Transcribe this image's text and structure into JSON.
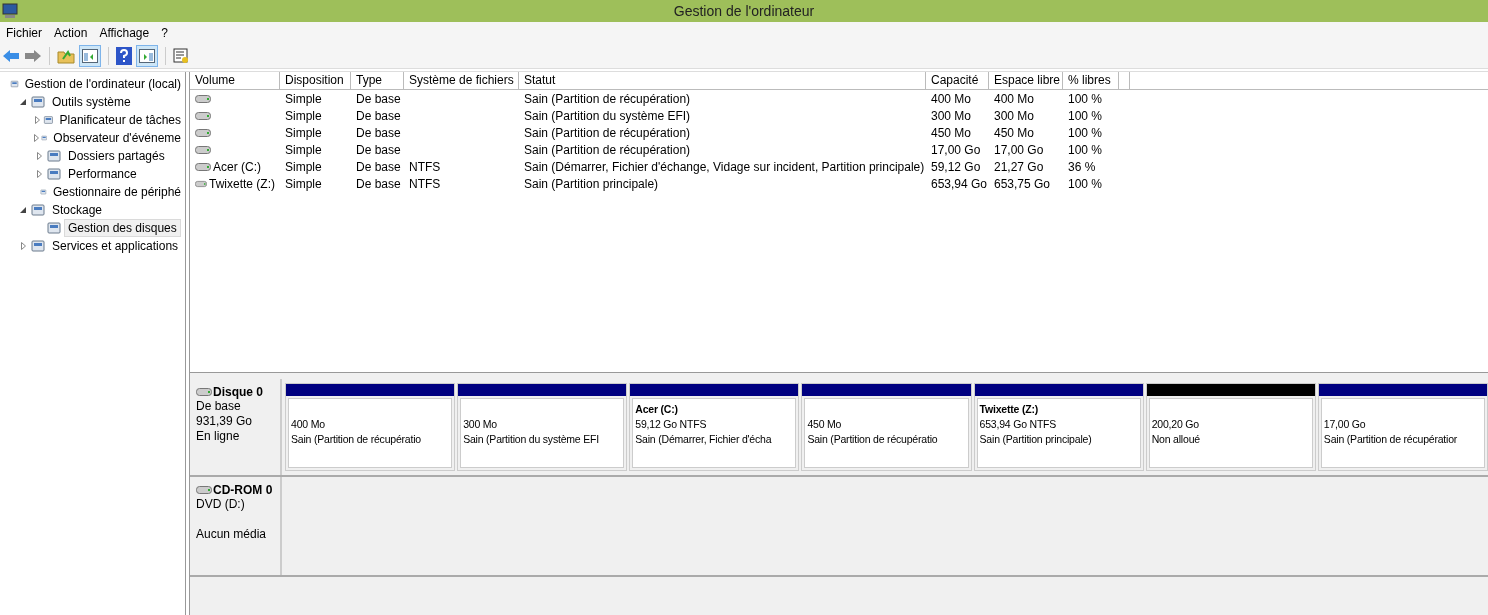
{
  "window": {
    "title": "Gestion de l'ordinateur"
  },
  "menu": [
    "Fichier",
    "Action",
    "Affichage",
    "?"
  ],
  "tree": [
    {
      "label": "Gestion de l'ordinateur (local)",
      "selected": false,
      "children": [
        {
          "label": "Outils système",
          "expanded": true,
          "selected": false,
          "children": [
            {
              "label": "Planificateur de tâches",
              "expanded": false,
              "selected": false
            },
            {
              "label": "Observateur d'événeme",
              "expanded": false,
              "selected": false
            },
            {
              "label": "Dossiers partagés",
              "expanded": false,
              "selected": false
            },
            {
              "label": "Performance",
              "expanded": false,
              "selected": false
            },
            {
              "label": "Gestionnaire de périphé",
              "selected": false
            }
          ]
        },
        {
          "label": "Stockage",
          "expanded": true,
          "selected": false,
          "children": [
            {
              "label": "Gestion des disques",
              "selected": true
            }
          ]
        },
        {
          "label": "Services et applications",
          "expanded": false,
          "selected": false
        }
      ]
    }
  ],
  "table": {
    "columns": [
      "Volume",
      "Disposition",
      "Type",
      "Système de fichiers",
      "Statut",
      "Capacité",
      "Espace libre",
      "% libres"
    ],
    "rows": [
      [
        "",
        "Simple",
        "De base",
        "",
        "Sain (Partition de récupération)",
        "400 Mo",
        "400 Mo",
        "100 %"
      ],
      [
        "",
        "Simple",
        "De base",
        "",
        "Sain (Partition du système EFI)",
        "300 Mo",
        "300 Mo",
        "100 %"
      ],
      [
        "",
        "Simple",
        "De base",
        "",
        "Sain (Partition de récupération)",
        "450 Mo",
        "450 Mo",
        "100 %"
      ],
      [
        "",
        "Simple",
        "De base",
        "",
        "Sain (Partition de récupération)",
        "17,00 Go",
        "17,00 Go",
        "100 %"
      ],
      [
        "Acer (C:)",
        "Simple",
        "De base",
        "NTFS",
        "Sain (Démarrer, Fichier d'échange, Vidage sur incident, Partition principale)",
        "59,12 Go",
        "21,27 Go",
        "36 %"
      ],
      [
        "Twixette (Z:)",
        "Simple",
        "De base",
        "NTFS",
        "Sain (Partition principale)",
        "653,94 Go",
        "653,75 Go",
        "100 %"
      ]
    ]
  },
  "disks": [
    {
      "name": "Disque 0",
      "type": "De base",
      "size": "931,39 Go",
      "status": "En ligne",
      "partitions": [
        {
          "kind": "primary",
          "size": "400 Mo",
          "status": "Sain (Partition de récupératio"
        },
        {
          "kind": "primary",
          "size": "300 Mo",
          "status": "Sain (Partition du système EFI"
        },
        {
          "kind": "primary",
          "name": "Acer  (C:)",
          "size": "59,12 Go NTFS",
          "status": "Sain (Démarrer, Fichier d'écha"
        },
        {
          "kind": "primary",
          "size": "450 Mo",
          "status": "Sain (Partition de récupératio"
        },
        {
          "kind": "primary",
          "name": "Twixette  (Z:)",
          "size": "653,94 Go NTFS",
          "status": "Sain (Partition principale)"
        },
        {
          "kind": "unallocated",
          "size": "200,20 Go",
          "status": "Non alloué"
        },
        {
          "kind": "primary",
          "size": "17,00 Go",
          "status": "Sain (Partition de récupératior"
        }
      ]
    },
    {
      "name": "CD-ROM 0",
      "type": "DVD (D:)",
      "status": "Aucun média"
    }
  ]
}
